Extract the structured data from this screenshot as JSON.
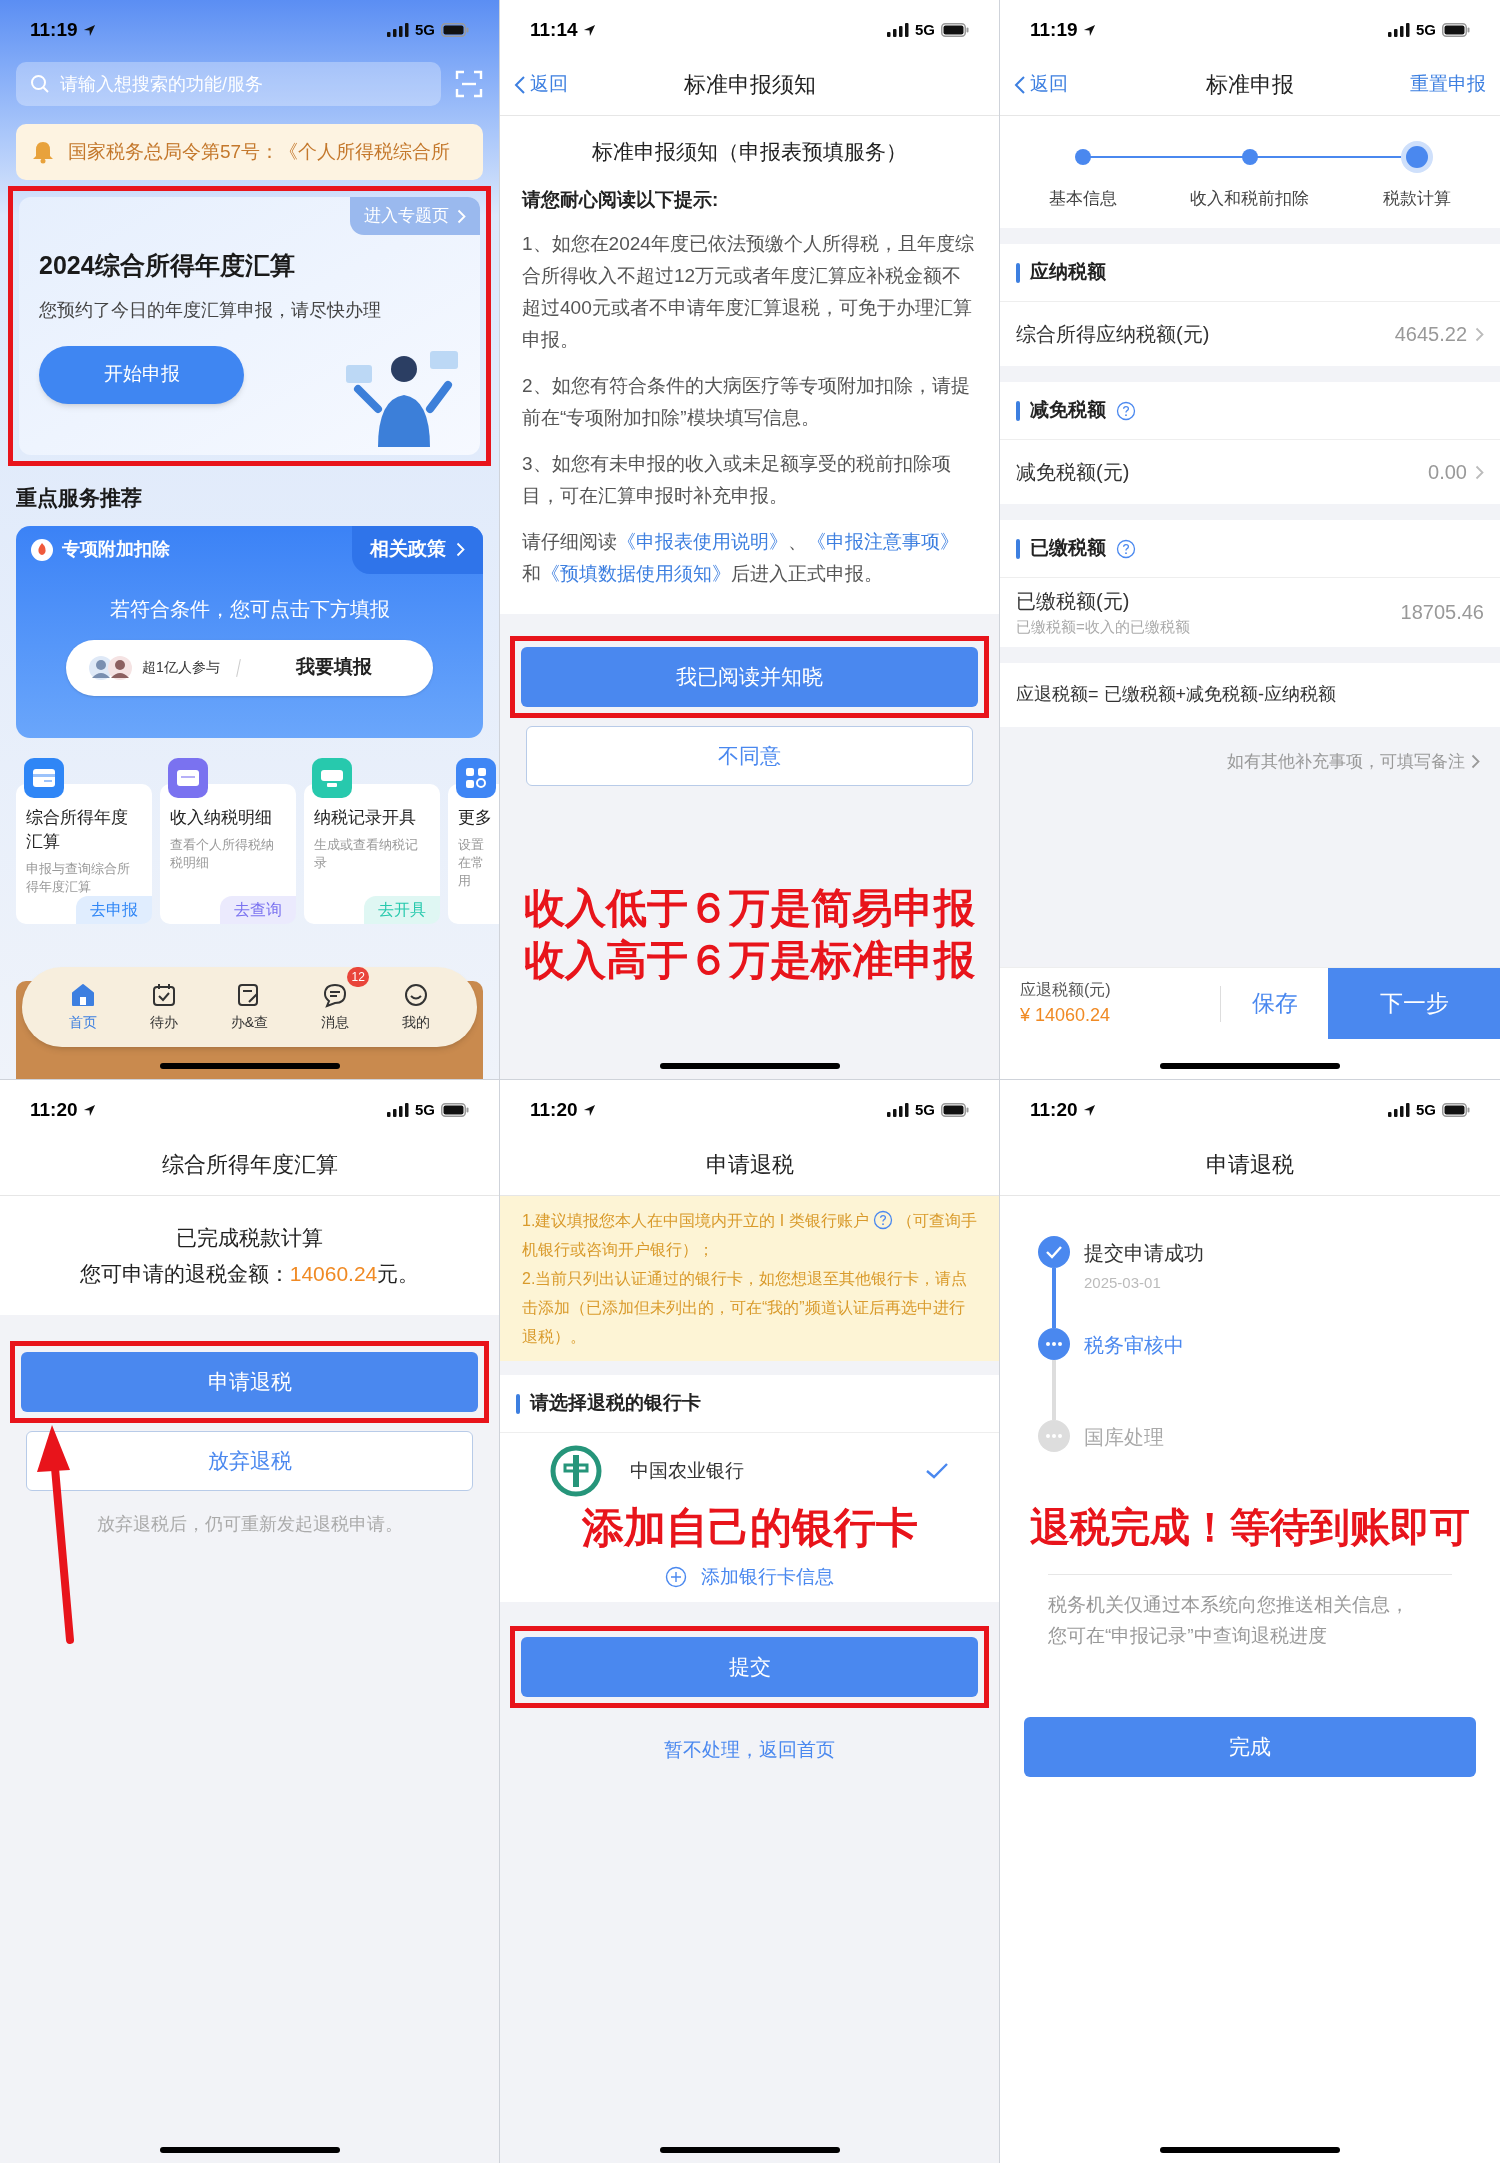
{
  "home": {
    "status_bar": {
      "time": "11:19",
      "network": "5G"
    },
    "search": {
      "placeholder": "请输入想搜索的功能/服务"
    },
    "notice": "国家税务总局令第57号：《个人所得税综合所",
    "hero": {
      "link": "进入专题页",
      "title": "2024综合所得年度汇算",
      "subtitle": "您预约了今日的年度汇算申报，请尽快办理",
      "button": "开始申报",
      "highlighted": true
    },
    "section_title": "重点服务推荐",
    "deduction_card": {
      "title": "专项附加扣除",
      "policy_link": "相关政策",
      "prompt": "若符合条件，您可点击下方填报",
      "participants": "超1亿人参与",
      "button": "我要填报"
    },
    "services": [
      {
        "title": "综合所得年度汇算",
        "desc": "申报与查询综合所得年度汇算",
        "action": "去申报",
        "color": "#2f86f6"
      },
      {
        "title": "收入纳税明细",
        "desc": "查看个人所得税纳税明细",
        "action": "去查询",
        "color": "#7a72f0"
      },
      {
        "title": "纳税记录开具",
        "desc": "生成或查看纳税记录",
        "action": "去开具",
        "color": "#27c9ad"
      }
    ],
    "more_card": {
      "title": "更多",
      "desc": "设置在常用",
      "color": "#3f86f5"
    },
    "tabs": [
      {
        "label": "首页",
        "selected": true
      },
      {
        "label": "待办",
        "selected": false
      },
      {
        "label": "办&查",
        "selected": false
      },
      {
        "label": "消息",
        "selected": false,
        "badge": "12"
      },
      {
        "label": "我的",
        "selected": false
      }
    ]
  },
  "notice_page": {
    "status_bar": {
      "time": "11:14",
      "network": "5G"
    },
    "back": "返回",
    "title": "标准申报须知",
    "heading": "标准申报须知（申报表预填服务）",
    "intro": "请您耐心阅读以下提示:",
    "items": [
      "1、如您在2024年度已依法预缴个人所得税，且年度综合所得收入不超过12万元或者年度汇算应补税金额不超过400元或者不申请年度汇算退税，可免于办理汇算申报。",
      "2、如您有符合条件的大病医疗等专项附加扣除，请提前在“专项附加扣除”模块填写信息。",
      "3、如您有未申报的收入或未足额享受的税前扣除项目，可在汇算申报时补充申报。"
    ],
    "reading": [
      {
        "text": "请仔细阅读",
        "link": false
      },
      {
        "text": "《申报表使用说明》",
        "link": true
      },
      {
        "text": "、",
        "link": false
      },
      {
        "text": "《申报注意事项》",
        "link": true
      },
      {
        "text": "和",
        "link": false
      },
      {
        "text": "《预填数据使用须知》",
        "link": true
      },
      {
        "text": "后进入正式申报。",
        "link": false
      }
    ],
    "agree_button": {
      "label": "我已阅读并知晓",
      "highlighted": true
    },
    "disagree_button": "不同意",
    "annotation": [
      "收入低于６万是简易申报",
      "收入高于６万是标准申报"
    ]
  },
  "calc_page": {
    "status_bar": {
      "time": "11:19",
      "network": "5G"
    },
    "back": "返回",
    "title": "标准申报",
    "reset": "重置申报",
    "steps": [
      {
        "label": "基本信息",
        "current": false
      },
      {
        "label": "收入和税前扣除",
        "current": false
      },
      {
        "label": "税款计算",
        "current": true
      }
    ],
    "sections": [
      {
        "title": "应纳税额",
        "help": false,
        "rows": [
          {
            "label": "综合所得应纳税额(元)",
            "value": "4645.22",
            "chevron": true
          }
        ]
      },
      {
        "title": "减免税额",
        "help": true,
        "rows": [
          {
            "label": "减免税额(元)",
            "value": "0.00",
            "chevron": true
          }
        ]
      },
      {
        "title": "已缴税额",
        "help": true,
        "rows": [
          {
            "label": "已缴税额(元)",
            "sublabel": "已缴税额=收入的已缴税额",
            "value": "18705.46",
            "chevron": false
          }
        ]
      }
    ],
    "formula": "应退税额= 已缴税额+减免税额-应纳税额",
    "remark_link": "如有其他补充事项，可填写备注",
    "refund_label": "应退税额(元)",
    "refund_amount": "¥ 14060.24",
    "save": "保存",
    "next": "下一步"
  },
  "result_page": {
    "status_bar": {
      "time": "11:20",
      "network": "5G"
    },
    "title": "综合所得年度汇算",
    "done": "已完成税款计算",
    "amount_label": "您可申请的退税金额：",
    "amount": "14060.24",
    "unit": "元。",
    "apply_button": {
      "label": "申请退税",
      "highlighted": true
    },
    "give_up_button": "放弃退税",
    "note": "放弃退税后，仍可重新发起退税申请。"
  },
  "bank_page": {
    "status_bar": {
      "time": "11:20",
      "network": "5G"
    },
    "title": "申请退税",
    "tips": {
      "first": "1.建议填报您本人在中国境内开立的 I 类银行账户",
      "first_note": "（可查询手机银行或咨询开户银行）；",
      "second": "2.当前只列出认证通过的银行卡，如您想退至其他银行卡，请点击添加（已添加但未列出的，可在“我的”频道认证后再选中进行退税）。"
    },
    "section_title": "请选择退税的银行卡",
    "banks": [
      {
        "name": "中国农业银行",
        "selected": true
      }
    ],
    "annotation": "添加自己的银行卡",
    "add_card": "添加银行卡信息",
    "submit": {
      "label": "提交",
      "highlighted": true
    },
    "skip_link": "暂不处理，返回首页"
  },
  "progress_page": {
    "status_bar": {
      "time": "11:20",
      "network": "5G"
    },
    "title": "申请退税",
    "steps": [
      {
        "label": "提交申请成功",
        "date": "2025-03-01",
        "completed": true,
        "current": false
      },
      {
        "label": "税务审核中",
        "completed": false,
        "current": true
      },
      {
        "label": "国库处理",
        "completed": false,
        "current": false
      }
    ],
    "annotation": "退税完成！等待到账即可",
    "info": "税务机关仅通过本系统向您推送相关信息，您可在“申报记录”中查询退税进度",
    "done_button": "完成"
  }
}
